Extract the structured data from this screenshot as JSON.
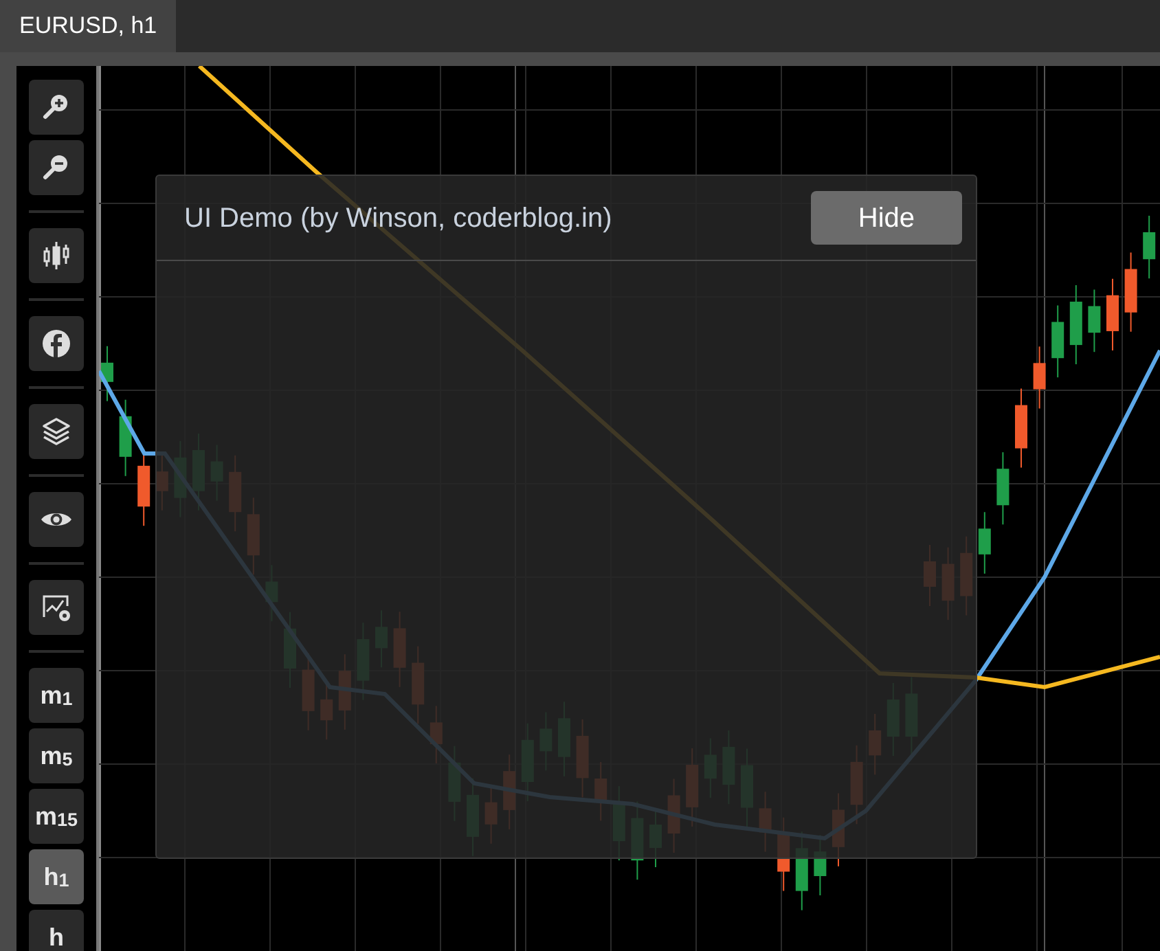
{
  "tab": {
    "label": "EURUSD, h1",
    "selected": true
  },
  "toolbar": [
    {
      "kind": "zoom-in",
      "selected": false,
      "separator_after": false
    },
    {
      "kind": "zoom-out",
      "selected": false,
      "separator_after": true
    },
    {
      "kind": "candles",
      "selected": false,
      "separator_after": true
    },
    {
      "kind": "facebook",
      "selected": false,
      "separator_after": true
    },
    {
      "kind": "layers",
      "selected": false,
      "separator_after": true
    },
    {
      "kind": "eye",
      "selected": false,
      "separator_after": true
    },
    {
      "kind": "chart-settings",
      "selected": false,
      "separator_after": true
    },
    {
      "kind": "timeframe",
      "label": "m$_{1}$",
      "selected": false,
      "separator_after": false
    },
    {
      "kind": "timeframe",
      "label": "m$_{5}$",
      "selected": false,
      "separator_after": false
    },
    {
      "kind": "timeframe",
      "label": "m$_{15}$",
      "selected": false,
      "separator_after": false
    },
    {
      "kind": "timeframe",
      "label": "h$_{1}$",
      "selected": true,
      "separator_after": false
    },
    {
      "kind": "timeframe",
      "label": "h",
      "selected": false,
      "separator_after": false
    }
  ],
  "panel": {
    "title": "UI Demo (by Winson, coderblog.in)",
    "button": "Hide"
  }
}
